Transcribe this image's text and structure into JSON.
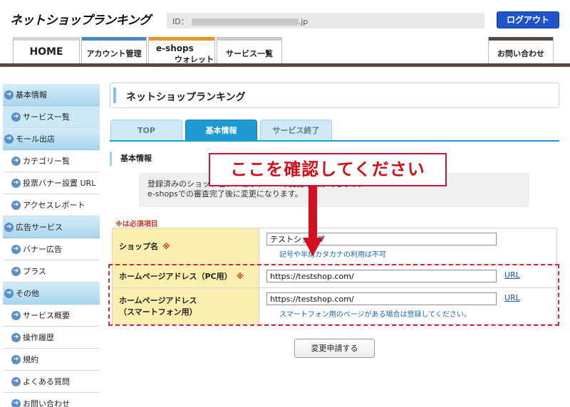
{
  "header": {
    "logo": "ネットショップランキング",
    "id_label": "ID：",
    "id_suffix": ".jp",
    "logout_label": "ログアウト"
  },
  "nav": {
    "home": "HOME",
    "account": "アカウント管理",
    "wallet_line1": "e-shops",
    "wallet_line2": "ウォレット",
    "services": "サービス一覧",
    "contact": "お問い合わせ"
  },
  "sidebar": {
    "sections": [
      {
        "label": "基本情報",
        "items": [
          "サービス一覧"
        ]
      },
      {
        "label": "モール出店",
        "items": [
          "カテゴリー覧",
          "投票バナー設置 URL",
          "アクセスレポート"
        ]
      },
      {
        "label": "広告サービス",
        "items": [
          "バナー広告",
          "プラス"
        ]
      },
      {
        "label": "その他",
        "items": [
          "サービス概要",
          "操作履歴",
          "規約",
          "よくある質問",
          "お問い合わせ"
        ]
      }
    ]
  },
  "main": {
    "page_title": "ネットショップランキング",
    "tabs": {
      "top": "TOP",
      "basic": "基本情報",
      "end": "サービス終了"
    },
    "section_title": "基本情報",
    "info_line1": "登録済みのショップ名、ショップURLの変更申請ができます。",
    "info_line2": "e-shopsでの審査完了後に変更になります。",
    "required_note": "※は必須項目",
    "fields": {
      "shop_name": {
        "label": "ショップ名",
        "required": "※",
        "value": "テストショップ",
        "hint": "記号や半角カタカナの利用は不可"
      },
      "pc_url": {
        "label": "ホームページアドレス（PC用）",
        "required": "※",
        "value": "https://testshop.com/",
        "link": "URL"
      },
      "sp_url": {
        "label_line1": "ホームページアドレス",
        "label_line2": "（スマートフォン用）",
        "value": "https://testshop.com/",
        "link": "URL",
        "hint": "スマートフォン用のページがある場合は登録してください。"
      }
    },
    "submit_label": "変更申請する"
  },
  "annotation": {
    "callout": "ここを確認してください"
  },
  "colors": {
    "logout_bg": "#1f55c8",
    "active_tab": "#1e9bd6",
    "label_bg": "#fbefb0",
    "required": "#d0381f",
    "annotation_red": "#d3101c"
  }
}
